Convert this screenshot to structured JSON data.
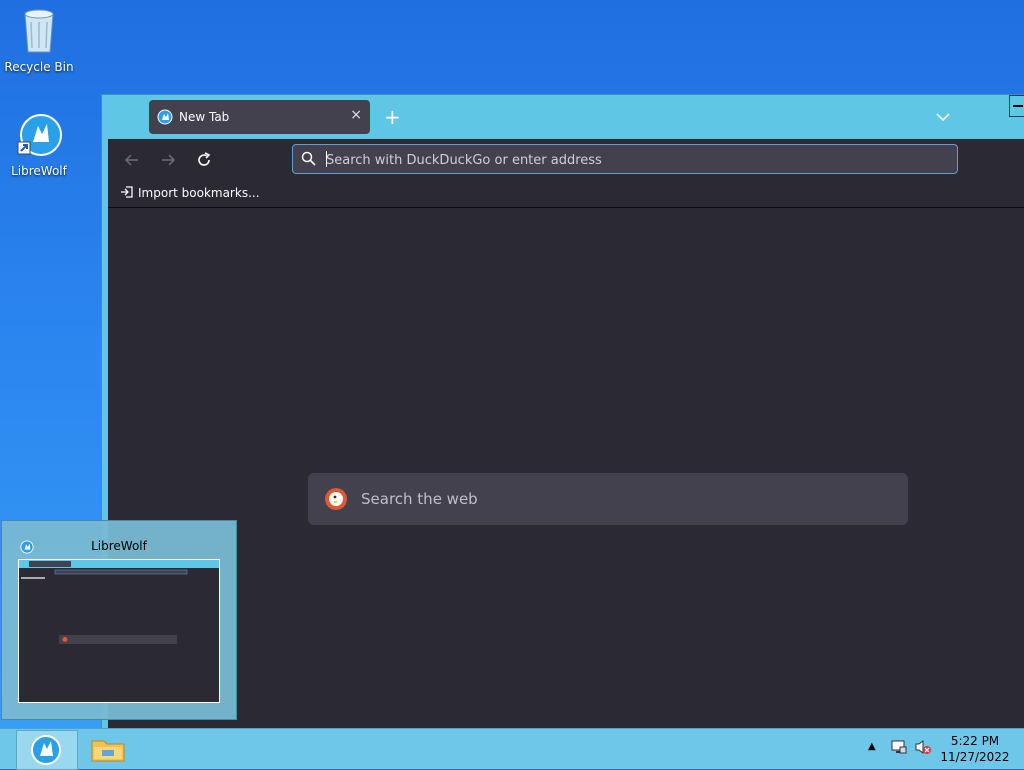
{
  "desktop": {
    "icons": [
      {
        "label": "Recycle Bin"
      },
      {
        "label": "LibreWolf"
      }
    ]
  },
  "browser": {
    "tab": {
      "title": "New Tab",
      "close": "×"
    },
    "new_tab": "+",
    "urlbar": {
      "placeholder": "Search with DuckDuckGo or enter address"
    },
    "bookmarks": {
      "import_label": "Import bookmarks..."
    },
    "search_web": {
      "placeholder": "Search the web"
    }
  },
  "preview": {
    "title": "LibreWolf"
  },
  "taskbar": {
    "clock": {
      "time": "5:22 PM",
      "date": "11/27/2022"
    },
    "tray_arrow": "▲"
  },
  "colors": {
    "accent": "#5fc6e6",
    "page_bg": "#2b2a33",
    "field_bg": "#42414d",
    "ddg": "#de5833"
  }
}
